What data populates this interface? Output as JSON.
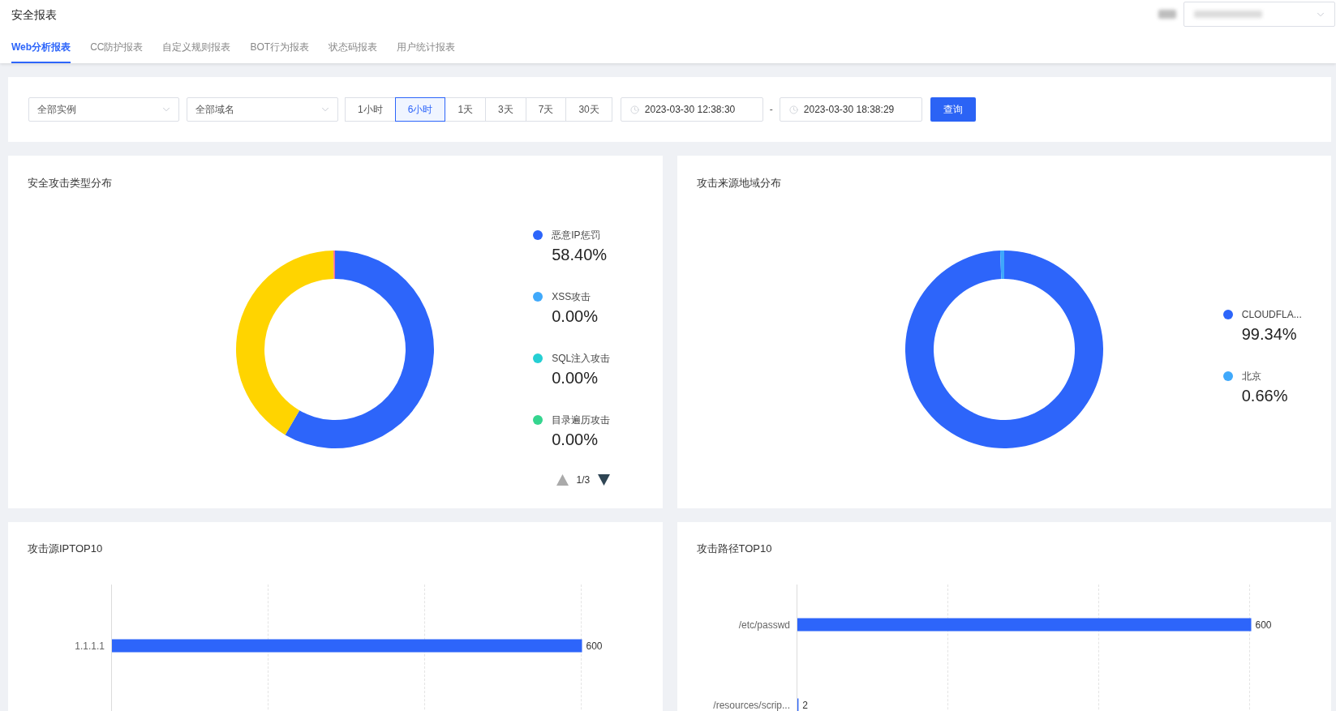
{
  "header": {
    "title": "安全报表",
    "tabs": [
      {
        "label": "Web分析报表",
        "selected": true
      },
      {
        "label": "CC防护报表",
        "selected": false
      },
      {
        "label": "自定义规则报表",
        "selected": false
      },
      {
        "label": "BOT行为报表",
        "selected": false
      },
      {
        "label": "状态码报表",
        "selected": false
      },
      {
        "label": "用户统计报表",
        "selected": false
      }
    ]
  },
  "filters": {
    "instance_select": {
      "value": "全部实例"
    },
    "domain_select": {
      "value": "全部域名"
    },
    "time_ranges": [
      {
        "label": "1小时",
        "selected": false
      },
      {
        "label": "6小时",
        "selected": true
      },
      {
        "label": "1天",
        "selected": false
      },
      {
        "label": "3天",
        "selected": false
      },
      {
        "label": "7天",
        "selected": false
      },
      {
        "label": "30天",
        "selected": false
      }
    ],
    "start_time": "2023-03-30 12:38:30",
    "separator": "-",
    "end_time": "2023-03-30 18:38:29",
    "query_button": "查询"
  },
  "panels": [
    {
      "title": "安全攻击类型分布",
      "legend": [
        {
          "label": "恶意IP惩罚",
          "value": "58.40%",
          "color": "#2d65fa"
        },
        {
          "label": "XSS攻击",
          "value": "0.00%",
          "color": "#40a9fb"
        },
        {
          "label": "SQL注入攻击",
          "value": "0.00%",
          "color": "#25cfd3"
        },
        {
          "label": "目录遍历攻击",
          "value": "0.00%",
          "color": "#35d58f"
        }
      ],
      "pager": {
        "text": "1/3",
        "prev_disabled": true,
        "next_disabled": false
      }
    },
    {
      "title": "攻击来源地域分布",
      "legend": [
        {
          "label": "CLOUDFLA...",
          "value": "99.34%",
          "color": "#2d65fa"
        },
        {
          "label": "北京",
          "value": "0.66%",
          "color": "#40a9fb"
        }
      ]
    }
  ],
  "top_charts": [
    {
      "title": "攻击源IPTOP10",
      "chart_data": {
        "type": "bar",
        "orientation": "horizontal",
        "categories": [
          "1.1.1.1"
        ],
        "values": [
          600
        ],
        "data_labels": true
      }
    },
    {
      "title": "攻击路径TOP10",
      "chart_data": {
        "type": "bar",
        "orientation": "horizontal",
        "categories": [
          "/etc/passwd",
          "/resources/scrip..."
        ],
        "values": [
          600,
          2
        ],
        "data_labels": true
      }
    }
  ]
}
